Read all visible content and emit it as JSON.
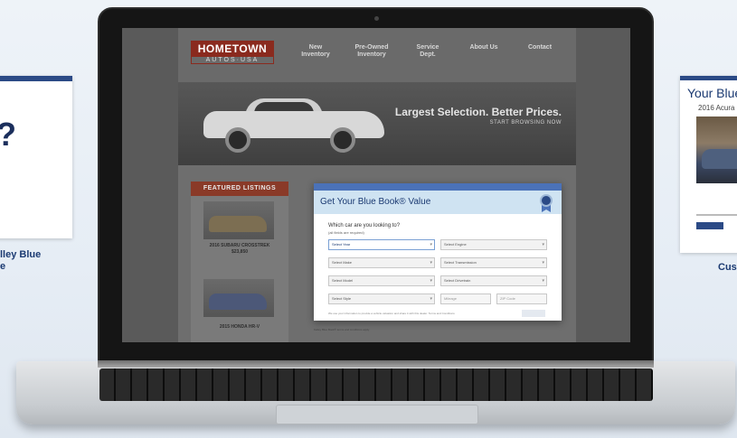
{
  "side_left": {
    "big_text": "?",
    "caption_line1": "lley Blue",
    "caption_line2": "e"
  },
  "side_right": {
    "title": "Your Blue",
    "subtitle": "2016 Acura R",
    "caption": "Cus"
  },
  "site": {
    "logo_top": "HOMETOWN",
    "logo_bottom": "AUTOS·USA",
    "nav": [
      {
        "label": "New\nInventory"
      },
      {
        "label": "Pre-Owned\nInventory"
      },
      {
        "label": "Service\nDept."
      },
      {
        "label": "About Us"
      },
      {
        "label": "Contact"
      }
    ],
    "hero_title": "Largest Selection. Better Prices.",
    "hero_sub": "START BROWSING NOW",
    "listings_header": "FEATURED LISTINGS",
    "listings": [
      {
        "caption_line1": "2016 SUBARU CROSSTREK",
        "caption_line2": "$23,850"
      },
      {
        "caption_line1": "2015 HONDA HR-V",
        "caption_line2": ""
      }
    ]
  },
  "modal": {
    "title": "Get Your Blue Book® Value",
    "question": "Which car are you looking to?",
    "question_sub": "(all fields are required)",
    "selects_left": [
      "Select Year",
      "Select Make",
      "Select Model",
      "Select Style"
    ],
    "selects_right": [
      "Select Engine",
      "Select Transmission",
      "Select Drivetrain"
    ],
    "mileage_placeholder": "Mileage",
    "zip_placeholder": "ZIP Code",
    "fine_print": "We use your information to provide a vehicle valuation and share it with this dealer. Terms and Conditions",
    "footer_note": "Kelley Blue Book® terms and conditions apply"
  }
}
